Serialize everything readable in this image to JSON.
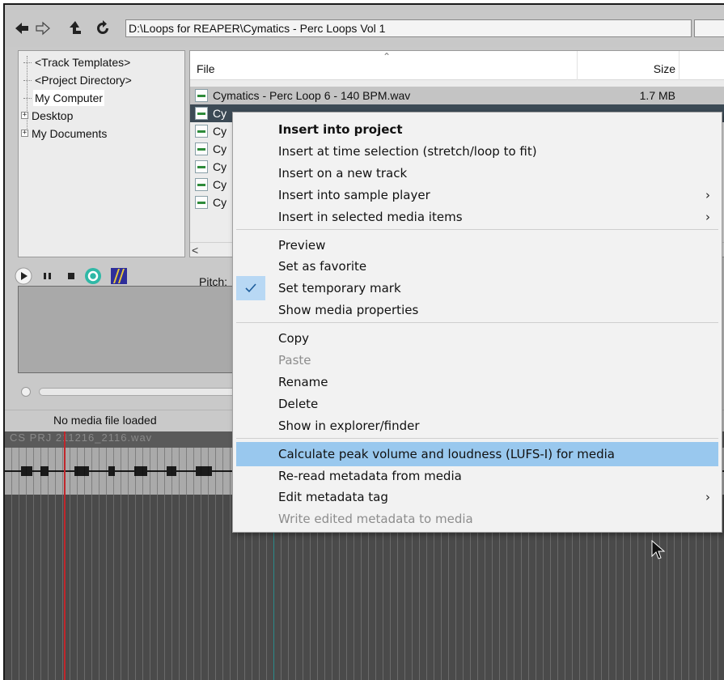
{
  "toolbar": {
    "path": "D:\\Loops for REAPER\\Cymatics - Perc Loops Vol 1",
    "icons": [
      "back-arrow-icon",
      "forward-arrow-icon",
      "up-folder-icon",
      "refresh-icon"
    ]
  },
  "tree": {
    "items": [
      {
        "label": "<Track Templates>"
      },
      {
        "label": "<Project Directory>"
      },
      {
        "label": "My Computer",
        "selected": true
      },
      {
        "label": "Desktop",
        "expander": "+"
      },
      {
        "label": "My Documents",
        "expander": "+"
      }
    ]
  },
  "filelist": {
    "col_file": "File",
    "col_size": "Size",
    "rows": [
      {
        "name": "Cymatics - Perc Loop 6 - 140 BPM.wav",
        "size": "1.7 MB"
      },
      {
        "name": "Cy",
        "size": ""
      },
      {
        "name": "Cy",
        "size": ""
      },
      {
        "name": "Cy",
        "size": ""
      },
      {
        "name": "Cy",
        "size": ""
      },
      {
        "name": "Cy",
        "size": ""
      },
      {
        "name": "Cy",
        "size": ""
      }
    ],
    "scroll_left": "<"
  },
  "transport": {
    "pitch_label": "Pitch:"
  },
  "status": {
    "text": "No media file loaded"
  },
  "arrange": {
    "item_name": "CS PRJ 211216_2116.wav"
  },
  "context_menu": {
    "items": [
      {
        "label": "Insert into project",
        "bold": true
      },
      {
        "label": "Insert at time selection (stretch/loop to fit)"
      },
      {
        "label": "Insert on a new track"
      },
      {
        "label": "Insert into sample player",
        "submenu": true
      },
      {
        "label": "Insert in selected media items",
        "submenu": true
      },
      {
        "separator": true
      },
      {
        "label": "Preview"
      },
      {
        "label": "Set as favorite"
      },
      {
        "label": "Set temporary mark",
        "checked": true
      },
      {
        "label": "Show media properties"
      },
      {
        "separator": true
      },
      {
        "label": "Copy"
      },
      {
        "label": "Paste",
        "disabled": true
      },
      {
        "label": "Rename"
      },
      {
        "label": "Delete"
      },
      {
        "label": "Show in explorer/finder"
      },
      {
        "separator": true
      },
      {
        "label": "Calculate peak volume and loudness (LUFS-I) for media",
        "highlighted": true
      },
      {
        "label": "Re-read metadata from media"
      },
      {
        "label": "Edit metadata tag",
        "submenu": true
      },
      {
        "label": "Write edited metadata to media",
        "disabled": true
      }
    ]
  },
  "colors": {
    "menu_highlight": "#99c8ee",
    "check_background": "#b8d8f4",
    "playhead": "#c0262b",
    "accent_green": "#2e8b3a"
  }
}
